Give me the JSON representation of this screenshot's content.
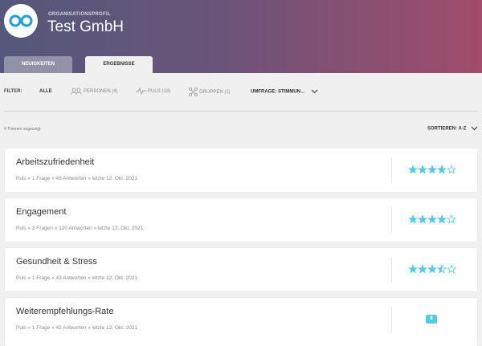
{
  "header": {
    "org_label": "ORGANISATIONSPROFIL",
    "org_name": "Test GmbH",
    "logo_icon": "infinity-logo-icon"
  },
  "tabs": [
    {
      "label": "NEUIGKEITEN",
      "active": false
    },
    {
      "label": "ERGEBNISSE",
      "active": true
    }
  ],
  "filter": {
    "label": "FILTER:",
    "all": "ALLE",
    "personen": "PERSONEN (4)",
    "puls": "PULS (13)",
    "gruppen": "GRUPPEN (1)",
    "umfrage": "UMFRAGE: STIMMUN..."
  },
  "list": {
    "count_text": "4 Themen angezeigt",
    "sort_label": "SORTIEREN: A-Z"
  },
  "colors": {
    "star": "#56c9e6",
    "header_start": "#54587a",
    "header_end": "#a04c6a"
  },
  "cards": [
    {
      "title": "Arbeitszufriedenheit",
      "meta": "Puls  »  1 Frage  »  43 Antworten  »  letzte 12. Okt. 2021",
      "rating": 4
    },
    {
      "title": "Engagement",
      "meta": "Puls  »  3 Fragen  »  120 Antworten  »  letzte 12. Okt. 2021",
      "rating": 4
    },
    {
      "title": "Gesundheit & Stress",
      "meta": "Puls  »  1 Frage  »  43 Antworten  »  letzte 12. Okt. 2021",
      "rating": 3.5
    },
    {
      "title": "Weiterempfehlungs-Rate",
      "meta": "Puls  »  1 Frage  »  42 Antworten  »  letzte 12. Okt. 2021",
      "badge": "8"
    }
  ]
}
